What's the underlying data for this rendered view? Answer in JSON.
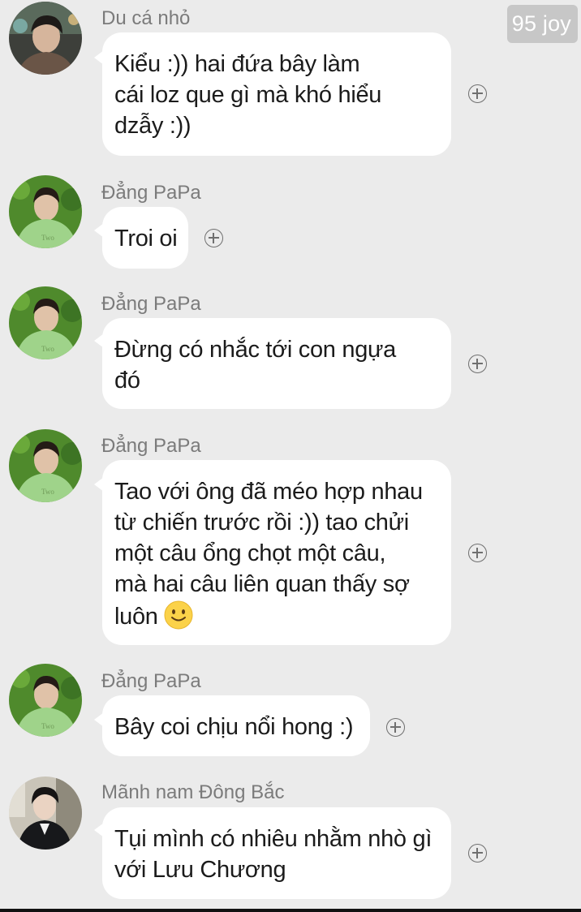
{
  "watermark": "95 joy",
  "messages": [
    {
      "sender": "Du cá nhỏ",
      "avatar": "dark-haired-boy-avatar",
      "lines": [
        "Kiểu :)) hai đứa bây làm",
        "cái loz que gì mà khó hiểu",
        "dzẫy :))"
      ]
    },
    {
      "sender": "Đẳng PaPa",
      "avatar": "green-shirt-boy-avatar",
      "lines": [
        "Troi oi"
      ]
    },
    {
      "sender": "Đẳng PaPa",
      "avatar": "green-shirt-boy-avatar",
      "lines": [
        "Đừng có nhắc tới con ngựa",
        "đó"
      ]
    },
    {
      "sender": "Đẳng PaPa",
      "avatar": "green-shirt-boy-avatar",
      "lines": [
        "Tao với ông đã méo hợp nhau",
        "từ chiến trước rồi :)) tao chửi",
        "một câu ổng chọt một câu,",
        "mà hai câu liên quan thấy sợ",
        "luôn"
      ],
      "trailing_emoji": "slightly-smiling-face-emoji"
    },
    {
      "sender": "Đẳng PaPa",
      "avatar": "green-shirt-boy-avatar",
      "lines": [
        "Bây coi chịu nổi hong :)"
      ]
    },
    {
      "sender": "Mãnh nam Đông Bắc",
      "avatar": "black-suit-boy-avatar",
      "lines": [
        "Tụi mình có nhiêu nhằm nhò gì",
        "với Lưu Chương"
      ]
    }
  ],
  "react_icon": "add-reaction-icon",
  "colors": {
    "background": "#ebebeb",
    "bubble": "#ffffff",
    "sender_name": "#7b7b7b",
    "message_text": "#1b1b1b",
    "watermark_bg": "#c7c7c7"
  }
}
